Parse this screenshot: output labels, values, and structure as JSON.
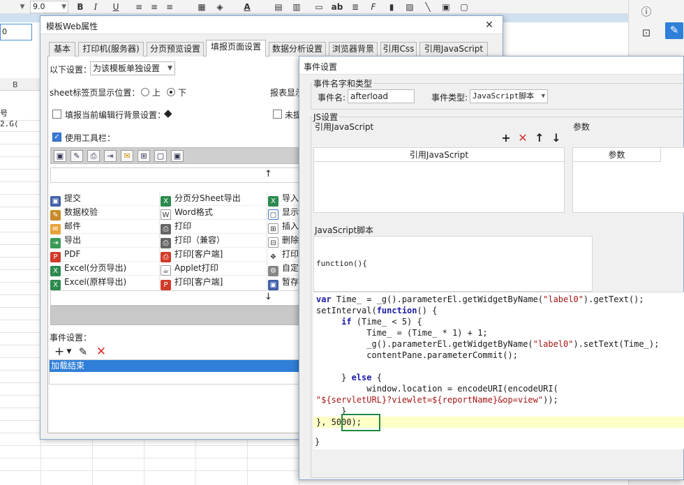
{
  "app": {
    "font_size": "9.0",
    "formula_cell_value": "0",
    "column_b": "B",
    "cell_text_1": "号",
    "cell_text_2": "2.G("
  },
  "dialog1": {
    "title": "模板Web属性",
    "close_label": "✕",
    "tabs": [
      "基本",
      "打印机(服务器)",
      "分页预览设置",
      "填报页面设置",
      "数据分析设置",
      "浏览器背景",
      "引用Css",
      "引用JavaScript"
    ],
    "active_tab": "填报页面设置",
    "setting_label": "以下设置：",
    "setting_value": "为该模板单独设置",
    "sheet_pos_label": "sheet标签页显示位置：",
    "radio_top": "上",
    "radio_bottom": "下",
    "report_display_label": "报表显示",
    "bg_label": "填报当前编辑行背景设置：",
    "unfilled_label": "未提",
    "use_toolbar_label": "使用工具栏：",
    "list_col1": [
      "提交",
      "数据校验",
      "邮件",
      "导出",
      "PDF",
      "Excel(分页导出)",
      "Excel(原样导出)"
    ],
    "list_col2": [
      "分页分Sheet导出",
      "Word格式",
      "打印",
      "打印（兼容）",
      "打印[客户端]",
      "Applet打印",
      "打印[客户端]"
    ],
    "list_col3": [
      "导入",
      "显示",
      "插入",
      "删除",
      "打印",
      "自定",
      "暂存"
    ],
    "event_label": "事件设置：",
    "event_item": "加载结束"
  },
  "dialog2": {
    "title": "事件设置",
    "group_name_type": "事件名字和类型",
    "event_name_label": "事件名:",
    "event_name_value": "afterload",
    "event_type_label": "事件类型:",
    "event_type_value": "JavaScript脚本",
    "group_js": "JS设置",
    "ref_js_label": "引用JavaScript",
    "params_label": "参数",
    "table_ref_header": "引用JavaScript",
    "table_params_header": "参数",
    "script_label": "JavaScript脚本",
    "func_header": "function(){",
    "code_end": "}"
  }
}
